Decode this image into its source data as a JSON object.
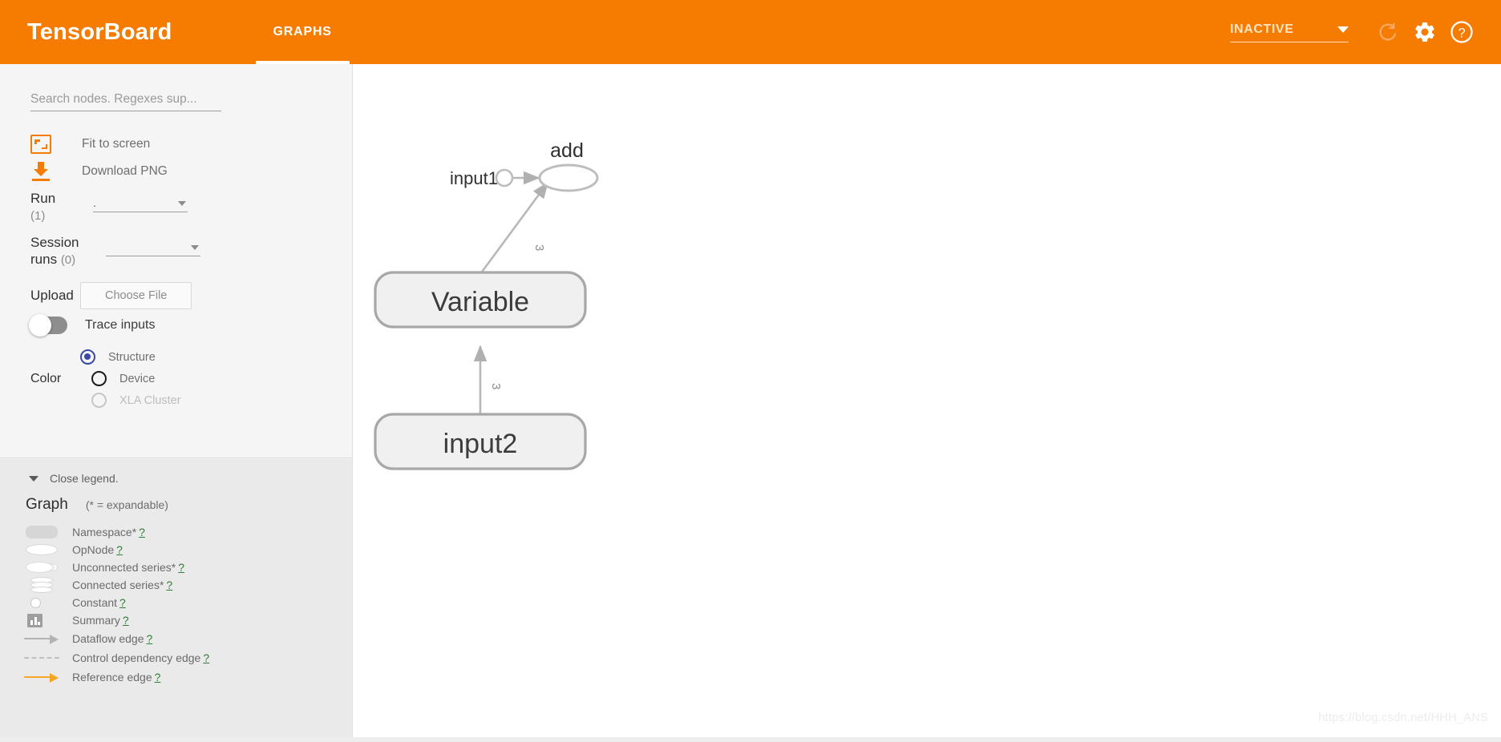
{
  "header": {
    "brand": "TensorBoard",
    "tabs": [
      {
        "label": "GRAPHS",
        "active": true
      }
    ],
    "status": {
      "value": "INACTIVE",
      "caret_icon": "caret-down-icon"
    },
    "icons": {
      "refresh": "refresh-icon",
      "settings": "gear-icon",
      "help": "help-circle-icon"
    },
    "accent_color": "#f57c00"
  },
  "sidebar": {
    "search": {
      "placeholder": "Search nodes. Regexes sup...",
      "value": ""
    },
    "actions": [
      {
        "label": "Fit to screen",
        "icon": "fit-to-screen-icon"
      },
      {
        "label": "Download PNG",
        "icon": "download-icon"
      }
    ],
    "run": {
      "label": "Run",
      "count": "(1)",
      "value": "."
    },
    "session_runs": {
      "label": "Session runs",
      "count": "(0)",
      "value": ""
    },
    "upload": {
      "label": "Upload",
      "button_label": "Choose File"
    },
    "trace_inputs": {
      "label": "Trace inputs",
      "checked": false
    },
    "color": {
      "label": "Color",
      "options": [
        {
          "label": "Structure",
          "selected": true,
          "disabled": false
        },
        {
          "label": "Device",
          "selected": false,
          "disabled": false
        },
        {
          "label": "XLA Cluster",
          "selected": false,
          "disabled": true
        }
      ],
      "selected_color": "#3949ab"
    }
  },
  "legend": {
    "close_label": "Close legend.",
    "title": "Graph",
    "expandable_note": "(* = expandable)",
    "help_symbol": "?",
    "items": [
      {
        "label": "Namespace*",
        "icon": "namespace-shape-icon"
      },
      {
        "label": "OpNode",
        "icon": "opnode-shape-icon"
      },
      {
        "label": "Unconnected series*",
        "icon": "unconnected-series-icon"
      },
      {
        "label": "Connected series*",
        "icon": "connected-series-icon"
      },
      {
        "label": "Constant",
        "icon": "constant-shape-icon"
      },
      {
        "label": "Summary",
        "icon": "summary-shape-icon"
      },
      {
        "label": "Dataflow edge",
        "icon": "dataflow-edge-icon"
      },
      {
        "label": "Control dependency edge",
        "icon": "control-dependency-edge-icon"
      },
      {
        "label": "Reference edge",
        "icon": "reference-edge-icon"
      }
    ]
  },
  "graph": {
    "nodes": [
      {
        "id": "input1",
        "label": "input1",
        "type": "constant"
      },
      {
        "id": "add",
        "label": "add",
        "type": "opnode"
      },
      {
        "id": "Variable",
        "label": "Variable",
        "type": "namespace"
      },
      {
        "id": "input2",
        "label": "input2",
        "type": "namespace"
      }
    ],
    "edges": [
      {
        "from": "input1",
        "to": "add",
        "label": ""
      },
      {
        "from": "Variable",
        "to": "add",
        "label": "3"
      },
      {
        "from": "input2",
        "to": "Variable",
        "label": "3"
      }
    ]
  },
  "watermark": "https://blog.csdn.net/HHH_ANS"
}
